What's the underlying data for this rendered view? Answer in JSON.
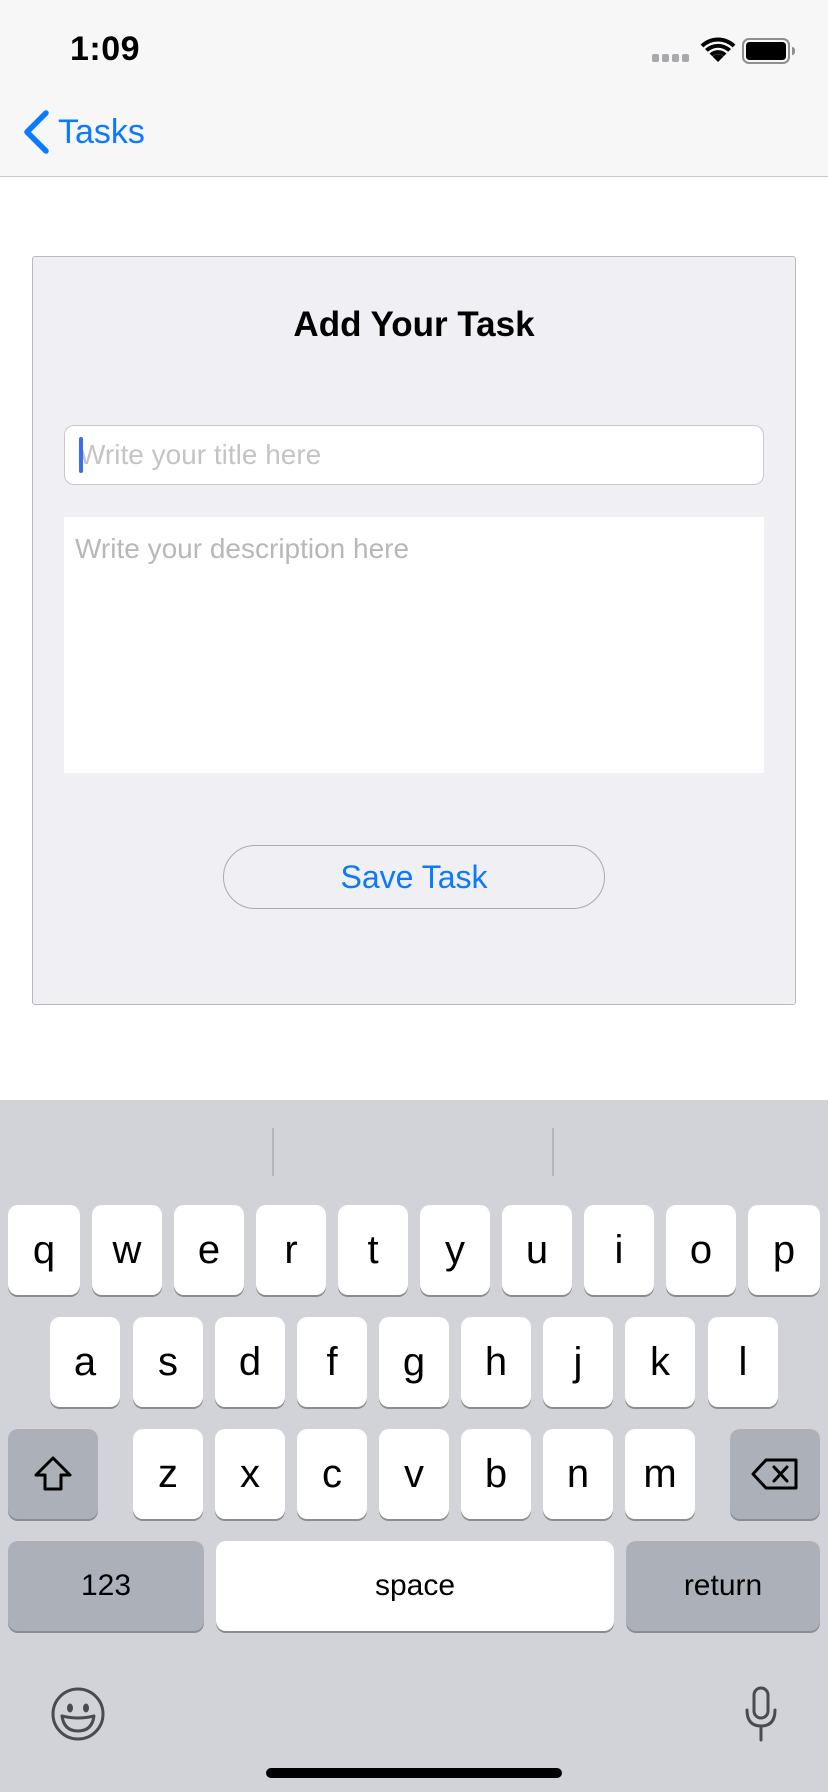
{
  "status_bar": {
    "time": "1:09"
  },
  "nav": {
    "back_label": "Tasks"
  },
  "form": {
    "title": "Add Your Task",
    "title_placeholder": "Write your title here",
    "description_placeholder": "Write your description here",
    "save_label": "Save Task"
  },
  "keyboard": {
    "row1": [
      "q",
      "w",
      "e",
      "r",
      "t",
      "y",
      "u",
      "i",
      "o",
      "p"
    ],
    "row2": [
      "a",
      "s",
      "d",
      "f",
      "g",
      "h",
      "j",
      "k",
      "l"
    ],
    "row3": [
      "z",
      "x",
      "c",
      "v",
      "b",
      "n",
      "m"
    ],
    "numbers_label": "123",
    "space_label": "space",
    "return_label": "return"
  },
  "colors": {
    "accent": "#0a7aff",
    "card_bg": "#efeff4",
    "keyboard_bg": "#d1d3d9"
  }
}
